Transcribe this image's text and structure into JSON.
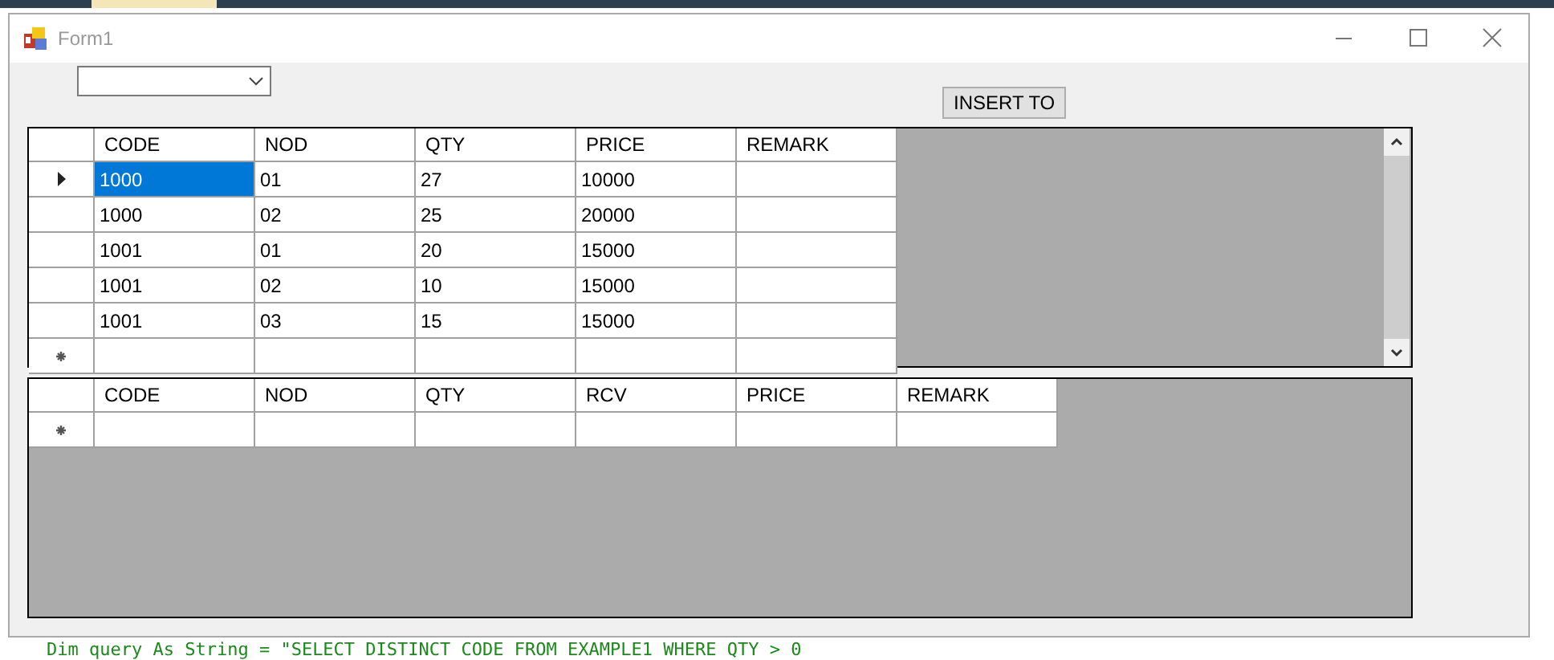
{
  "window": {
    "title": "Form1"
  },
  "insert_button": {
    "label": "INSERT TO"
  },
  "grid_1": {
    "columns": [
      "CODE",
      "NOD",
      "QTY",
      "PRICE",
      "REMARK"
    ],
    "rows": [
      {
        "kind": "data",
        "current": true,
        "cells": [
          {
            "text": "1000",
            "selected": true
          },
          {
            "text": "01",
            "selected": false
          },
          {
            "text": "27",
            "selected": false
          },
          {
            "text": "10000",
            "selected": false
          },
          {
            "text": "",
            "selected": false
          }
        ]
      },
      {
        "kind": "data",
        "current": false,
        "cells": [
          {
            "text": "1000",
            "selected": false
          },
          {
            "text": "02",
            "selected": false
          },
          {
            "text": "25",
            "selected": false
          },
          {
            "text": "20000",
            "selected": false
          },
          {
            "text": "",
            "selected": false
          }
        ]
      },
      {
        "kind": "data",
        "current": false,
        "cells": [
          {
            "text": "1001",
            "selected": false
          },
          {
            "text": "01",
            "selected": false
          },
          {
            "text": "20",
            "selected": false
          },
          {
            "text": "15000",
            "selected": false
          },
          {
            "text": "",
            "selected": false
          }
        ]
      },
      {
        "kind": "data",
        "current": false,
        "cells": [
          {
            "text": "1001",
            "selected": false
          },
          {
            "text": "02",
            "selected": false
          },
          {
            "text": "10",
            "selected": false
          },
          {
            "text": "15000",
            "selected": false
          },
          {
            "text": "",
            "selected": false
          }
        ]
      },
      {
        "kind": "data",
        "current": false,
        "cells": [
          {
            "text": "1001",
            "selected": false
          },
          {
            "text": "03",
            "selected": false
          },
          {
            "text": "15",
            "selected": false
          },
          {
            "text": "15000",
            "selected": false
          },
          {
            "text": "",
            "selected": false
          }
        ]
      },
      {
        "kind": "new",
        "current": false,
        "cells": [
          {
            "text": "",
            "selected": false
          },
          {
            "text": "",
            "selected": false
          },
          {
            "text": "",
            "selected": false
          },
          {
            "text": "",
            "selected": false
          },
          {
            "text": "",
            "selected": false
          }
        ]
      }
    ]
  },
  "grid_2": {
    "columns": [
      "CODE",
      "NOD",
      "QTY",
      "RCV",
      "PRICE",
      "REMARK"
    ],
    "rows": [
      {
        "kind": "new",
        "current": false,
        "cells": [
          {
            "text": "",
            "selected": false
          },
          {
            "text": "",
            "selected": false
          },
          {
            "text": "",
            "selected": false
          },
          {
            "text": "",
            "selected": false
          },
          {
            "text": "",
            "selected": false
          },
          {
            "text": "",
            "selected": false
          }
        ]
      }
    ]
  },
  "editor_behind": {
    "code_line": "Dim query As String = \"SELECT DISTINCT CODE FROM EXAMPLE1 WHERE QTY > 0"
  }
}
